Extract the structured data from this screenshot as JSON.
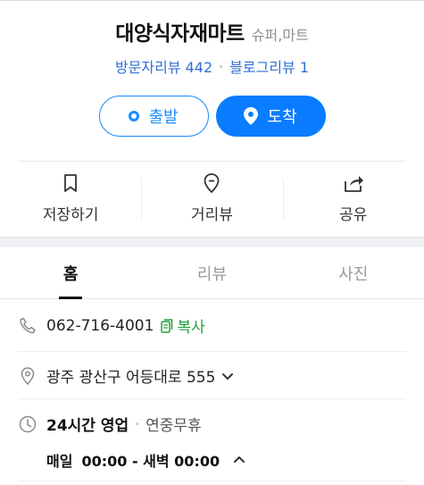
{
  "place": {
    "name": "대양식자재마트",
    "category": "슈퍼,마트",
    "visitor_reviews": "방문자리뷰 442",
    "blog_reviews": "블로그리뷰 1"
  },
  "buttons": {
    "start": "출발",
    "arrive": "도착"
  },
  "actions": {
    "save": "저장하기",
    "distance_review": "거리뷰",
    "share": "공유"
  },
  "tabs": [
    {
      "label": "홈",
      "active": true
    },
    {
      "label": "리뷰",
      "active": false
    },
    {
      "label": "사진",
      "active": false
    }
  ],
  "info": {
    "phone": "062-716-4001",
    "copy_label": "복사",
    "address": "광주 광산구 어등대로 555",
    "hours_status": "24시간 영업",
    "hours_note": "연중무휴",
    "hours_day": "매일",
    "hours_range": "00:00 - 새벽 00:00"
  },
  "colors": {
    "primary": "#0a7cff",
    "link": "#2f6fd3",
    "copy_green": "#22a03a"
  },
  "icons": [
    "bookmark-icon",
    "location-pin-icon",
    "share-icon",
    "phone-icon",
    "map-pin-icon",
    "clock-icon",
    "copy-icon",
    "chevron-down-icon",
    "chevron-up-icon"
  ]
}
